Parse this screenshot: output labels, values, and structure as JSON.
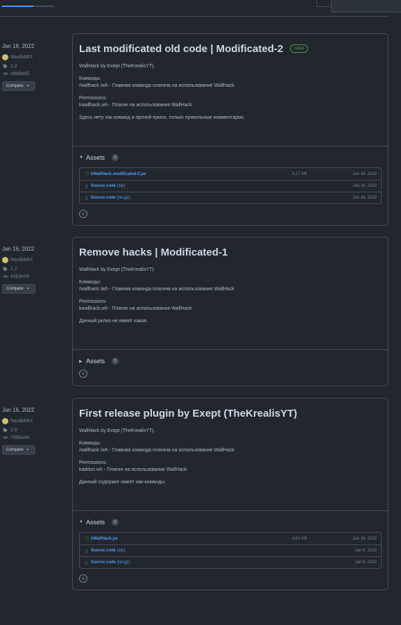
{
  "releases": [
    {
      "date": "Jan 16, 2022",
      "author": "NaulbiMIX",
      "tag": "1.2",
      "commit": "cdb8ad3",
      "compare_label": "Compare",
      "title": "Last modificated old code | Modificated-2",
      "badge": "Latest",
      "notes": {
        "line1": "WallHack by Exept (TheKrealisYT).",
        "commands_heading": "Команды:",
        "commands_line": "/wallhack /wh - Главная команда плагина на использование WallHack",
        "permissions_heading": "Permissions:",
        "permissions_line": "kwallhack.wh - Плагин на использование WallHack",
        "extra": "Здесь нету хак команд и прочей ериси, только прикольные комментарии."
      },
      "assets_label": "Assets",
      "assets_count": "3",
      "assets": [
        {
          "name": "kWallHack.modificated-2.jar",
          "sub": "",
          "size": "3.27 KB",
          "date": "Jan 16, 2022"
        },
        {
          "name": "Source code",
          "sub": "(zip)",
          "size": "",
          "date": "Jan 16, 2022"
        },
        {
          "name": "Source code",
          "sub": "(tar.gz)",
          "size": "",
          "date": "Jan 16, 2022"
        }
      ]
    },
    {
      "date": "Jan 16, 2022",
      "author": "NaulbiMIX",
      "tag": "1.1",
      "commit": "41b3e99",
      "compare_label": "Compare",
      "title": "Remove hacks | Modificated-1",
      "notes": {
        "line1": "WallHack by Exept (TheKrealisYT).",
        "commands_heading": "Команды:",
        "commands_line": "/wallhack /wh - Главная команда плагина на использование WallHack",
        "permissions_heading": "Permissions:",
        "permissions_line": "kwallhack.wh - Плагин на использование WallHack",
        "extra": "Данный релиз не имеет каков."
      },
      "assets_label": "Assets",
      "assets_count": "3"
    },
    {
      "date": "Jan 16, 2022",
      "author": "NaulbiMIX",
      "tag": "1.0",
      "commit": "7d88ad4",
      "compare_label": "Compare",
      "title": "First release plugin by Exept (TheKrealisYT)",
      "notes": {
        "line1": "WallHack by Exept (TheKrealisYT).",
        "commands_heading": "Команды:",
        "commands_line": "/wallhack /wh - Главная команда плагина на использование WallHack",
        "permissions_heading": "Permissions:",
        "permissions_line": "kaddon.wh - Плагин на использование WallHack",
        "extra": "Данный содержит имеет хак-команды."
      },
      "assets_label": "Assets",
      "assets_count": "3",
      "assets": [
        {
          "name": "kWallHack.jar",
          "sub": "",
          "size": "4.81 KB",
          "date": "Jan 16, 2022"
        },
        {
          "name": "Source code",
          "sub": "(zip)",
          "size": "",
          "date": "Jan 6, 2022"
        },
        {
          "name": "Source code",
          "sub": "(tar.gz)",
          "size": "",
          "date": "Jan 6, 2022"
        }
      ]
    }
  ],
  "icons": {
    "tag": "tag-icon",
    "commit": "git-commit-icon",
    "package": "package-icon",
    "file_zip": "file-zip-icon",
    "smiley": "smiley-icon",
    "triangle_down": "triangle-down-icon",
    "triangle_right": "triangle-right-icon"
  },
  "colors": {
    "background": "#22272e",
    "border": "#444c56",
    "link": "#539bf5",
    "latest": "#57ab5a"
  }
}
